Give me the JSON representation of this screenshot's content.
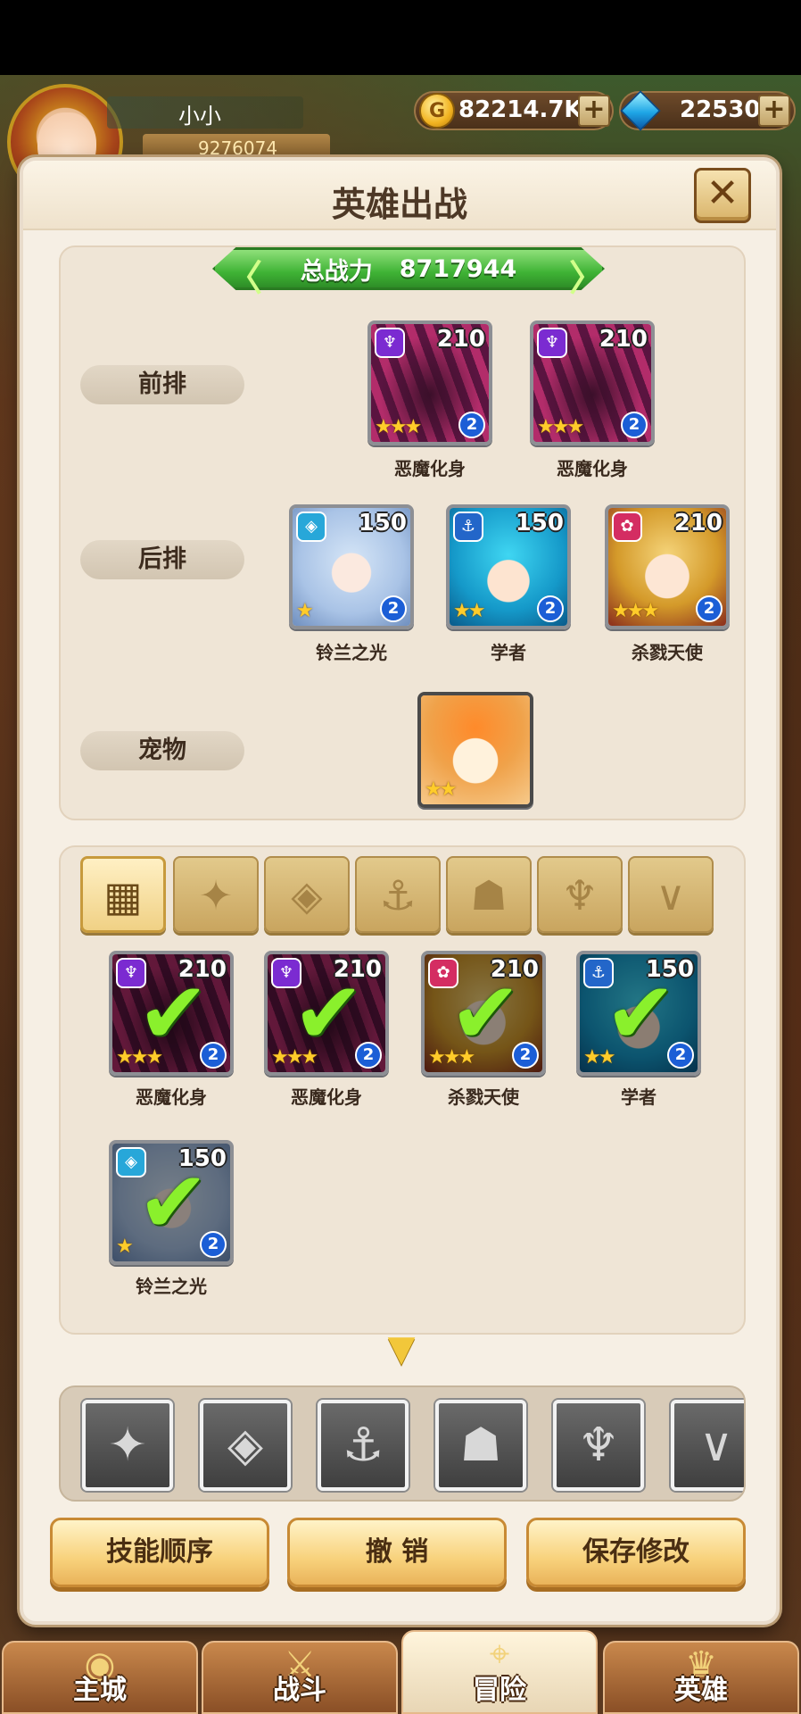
{
  "header": {
    "player_name": "小小",
    "player_power": "9276074",
    "gold": "82214.7K",
    "gems": "22530",
    "plus": "+"
  },
  "panel": {
    "title": "英雄出战",
    "close": "✕",
    "total_power_label": "总战力",
    "total_power_value": "8717944",
    "rows": {
      "front": "前排",
      "back": "后排",
      "pet": "宠物"
    },
    "front": [
      {
        "name": "恶魔化身",
        "level": "210",
        "grade": "2",
        "stars": "★★★",
        "faction_icon": "demon-faction-icon"
      },
      {
        "name": "恶魔化身",
        "level": "210",
        "grade": "2",
        "stars": "★★★",
        "faction_icon": "demon-faction-icon"
      }
    ],
    "back": [
      {
        "name": "铃兰之光",
        "level": "150",
        "grade": "2",
        "stars": "★",
        "faction_icon": "crystal-faction-icon"
      },
      {
        "name": "学者",
        "level": "150",
        "grade": "2",
        "stars": "★★",
        "faction_icon": "anchor-faction-icon"
      },
      {
        "name": "杀戮天使",
        "level": "210",
        "grade": "2",
        "stars": "★★★",
        "faction_icon": "flower-faction-icon"
      }
    ],
    "pet": {
      "stars": "★★"
    },
    "list": [
      {
        "name": "恶魔化身",
        "level": "210",
        "grade": "2",
        "stars": "★★★"
      },
      {
        "name": "恶魔化身",
        "level": "210",
        "grade": "2",
        "stars": "★★★"
      },
      {
        "name": "杀戮天使",
        "level": "210",
        "grade": "2",
        "stars": "★★★"
      },
      {
        "name": "学者",
        "level": "150",
        "grade": "2",
        "stars": "★★"
      },
      {
        "name": "铃兰之光",
        "level": "150",
        "grade": "2",
        "stars": "★"
      }
    ],
    "check": "✔",
    "tabs": [
      "grid-icon",
      "leaf-icon",
      "crystal-icon",
      "anchor-icon",
      "beast-icon",
      "horn-icon",
      "wing-icon"
    ],
    "buttons": {
      "skill_order": "技能顺序",
      "undo": "撤 销",
      "save": "保存修改"
    }
  },
  "nav": {
    "tabs": [
      "主城",
      "战斗",
      "冒险",
      "英雄"
    ]
  }
}
